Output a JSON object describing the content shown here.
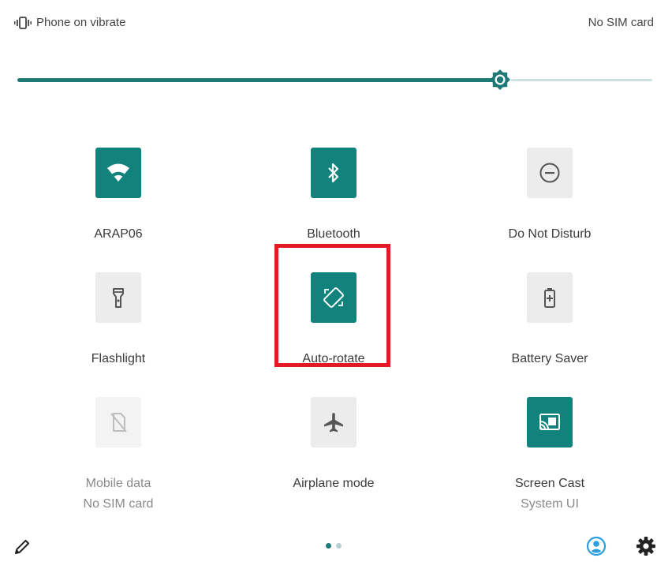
{
  "status_bar": {
    "left_icon": "vibrate-icon",
    "left_text": "Phone on vibrate",
    "right_text": "No SIM card"
  },
  "brightness": {
    "level": 0.76,
    "thumb_icon": "brightness-icon"
  },
  "tiles": {
    "wifi": {
      "label": "ARAP06",
      "state": "on",
      "icon": "wifi-icon"
    },
    "bluetooth": {
      "label": "Bluetooth",
      "state": "on",
      "icon": "bluetooth-icon"
    },
    "dnd": {
      "label": "Do Not Disturb",
      "state": "off",
      "icon": "do-not-disturb-icon"
    },
    "flashlight": {
      "label": "Flashlight",
      "state": "off",
      "icon": "flashlight-icon"
    },
    "autorotate": {
      "label": "Auto-rotate",
      "state": "on",
      "icon": "auto-rotate-icon",
      "highlighted": true
    },
    "battery_saver": {
      "label": "Battery Saver",
      "state": "off",
      "icon": "battery-saver-icon"
    },
    "mobile_data": {
      "label": "Mobile data",
      "sublabel": "No SIM card",
      "state": "disabled",
      "icon": "no-sim-icon"
    },
    "airplane": {
      "label": "Airplane mode",
      "state": "off",
      "icon": "airplane-icon"
    },
    "screen_cast": {
      "label": "Screen Cast",
      "sublabel": "System UI",
      "state": "on",
      "icon": "cast-icon"
    }
  },
  "bottom_bar": {
    "edit_icon": "pencil-icon",
    "page_indicator": {
      "pages": 2,
      "current": 1
    },
    "user_icon": "user-icon",
    "settings_icon": "gear-icon"
  },
  "colors": {
    "accent": "#12827c",
    "tile_off": "#ececec",
    "highlight": "#e11a23"
  }
}
